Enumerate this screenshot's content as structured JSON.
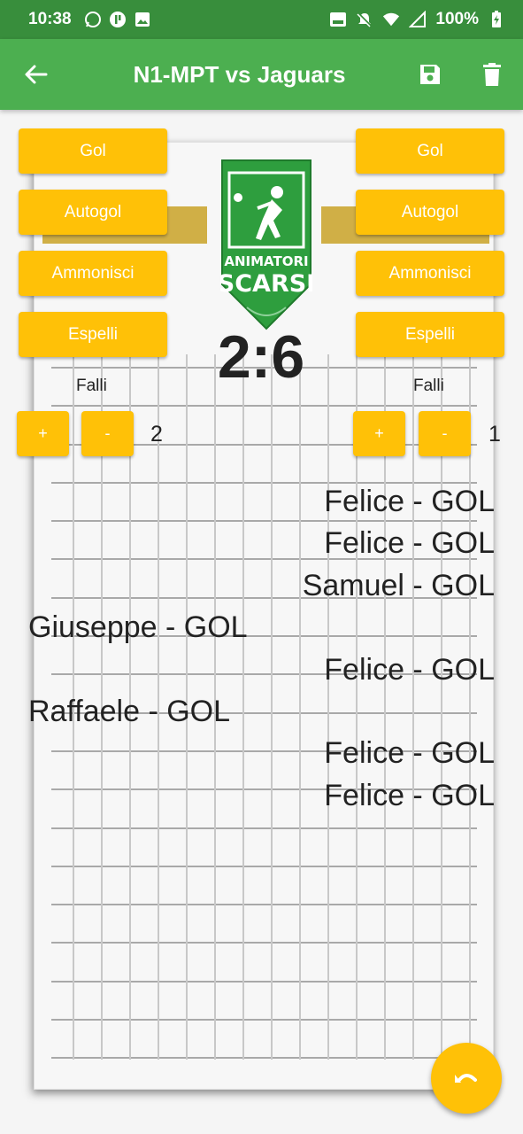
{
  "status_bar": {
    "time": "10:38",
    "battery": "100%"
  },
  "app_bar": {
    "title": "N1-MPT vs Jaguars"
  },
  "logo": {
    "line1": "ANIMATORI",
    "line2": "SCARSI"
  },
  "score": "2:6",
  "home": {
    "buttons": {
      "gol": "Gol",
      "autogol": "Autogol",
      "ammonisci": "Ammonisci",
      "espelli": "Espelli"
    },
    "falli_label": "Falli",
    "plus": "+",
    "minus": "-",
    "falli_count": "2"
  },
  "away": {
    "buttons": {
      "gol": "Gol",
      "autogol": "Autogol",
      "ammonisci": "Ammonisci",
      "espelli": "Espelli"
    },
    "falli_label": "Falli",
    "plus": "+",
    "minus": "-",
    "falli_count": "1"
  },
  "events": [
    {
      "text": "Felice - GOL",
      "side": "away"
    },
    {
      "text": "Felice - GOL",
      "side": "away"
    },
    {
      "text": "Samuel - GOL",
      "side": "away"
    },
    {
      "text": "Giuseppe - GOL",
      "side": "home"
    },
    {
      "text": "Felice - GOL",
      "side": "away"
    },
    {
      "text": "Raffaele - GOL",
      "side": "home"
    },
    {
      "text": "Felice - GOL",
      "side": "away"
    },
    {
      "text": "Felice - GOL",
      "side": "away"
    }
  ],
  "colors": {
    "status_bar": "#388e3c",
    "app_bar": "#4caf50",
    "accent": "#ffc107",
    "logo_green": "#2e9e3e"
  },
  "icons": {
    "back": "arrow-back-icon",
    "save": "save-icon",
    "delete": "delete-icon",
    "undo": "undo-icon"
  }
}
